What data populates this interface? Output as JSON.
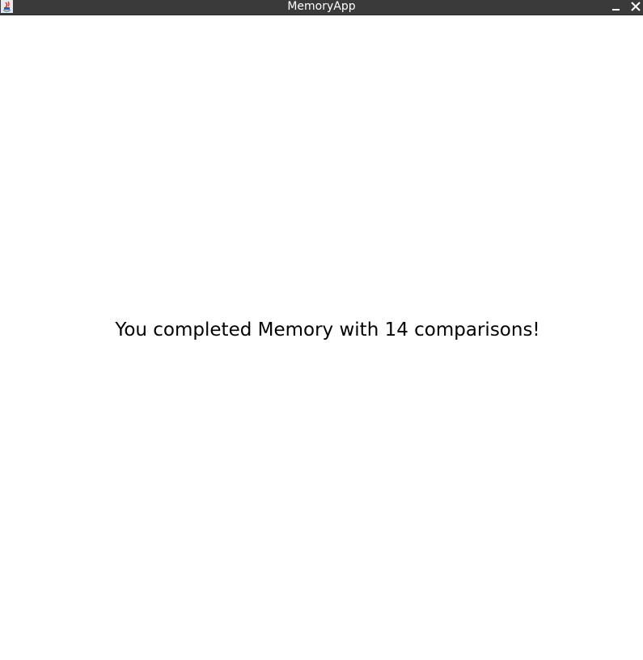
{
  "window": {
    "title": "MemoryApp",
    "controls": {
      "minimize_icon": "minimize-icon",
      "close_icon": "close-icon"
    },
    "titlebar_color": "#3a3a3a"
  },
  "app_icon": "java-app-icon",
  "content": {
    "message": "You completed Memory with 14 comparisons!",
    "background": "#ffffff"
  }
}
